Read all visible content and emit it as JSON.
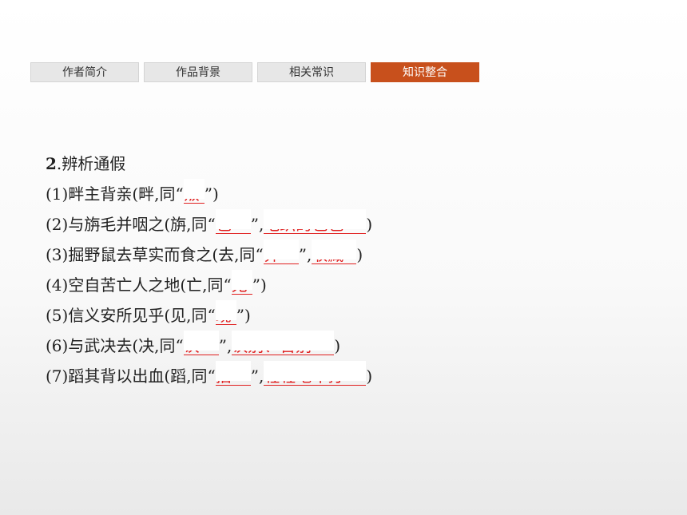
{
  "tabs": [
    {
      "label": "作者简介"
    },
    {
      "label": "作品背景"
    },
    {
      "label": "相关常识"
    },
    {
      "label": "知识整合",
      "active": true
    }
  ],
  "section": {
    "number": "2",
    "title": ".辨析通假"
  },
  "items": [
    {
      "prefix": "(1)畔主背亲(畔,同“",
      "a1": "叛",
      "mid": "",
      "a2": "",
      "suffix": "”)"
    },
    {
      "prefix": "(2)与旃毛并咽之(旃,同“",
      "a1": "毡",
      "mid": "”,",
      "a2": "毛织的毡毯",
      "suffix": ")"
    },
    {
      "prefix": "(3)掘野鼠去草实而食之(去,同“",
      "a1": "弆",
      "mid": "”,",
      "a2": "收藏",
      "suffix": ")"
    },
    {
      "prefix": "(4)空自苦亡人之地(亡,同“",
      "a1": "无",
      "mid": "",
      "a2": "",
      "suffix": "”)"
    },
    {
      "prefix": "(5)信义安所见乎(见,同“",
      "a1": "现",
      "mid": "",
      "a2": "",
      "suffix": "”)"
    },
    {
      "prefix": "(6)与武决去(决,同“",
      "a1": "诀",
      "mid": "”,",
      "a2": "诀别、告别",
      "suffix": ")"
    },
    {
      "prefix": "(7)蹈其背以出血(蹈,同“",
      "a1": "掐",
      "mid": "”,",
      "a2": "轻轻地叩打",
      "suffix": ")"
    }
  ]
}
